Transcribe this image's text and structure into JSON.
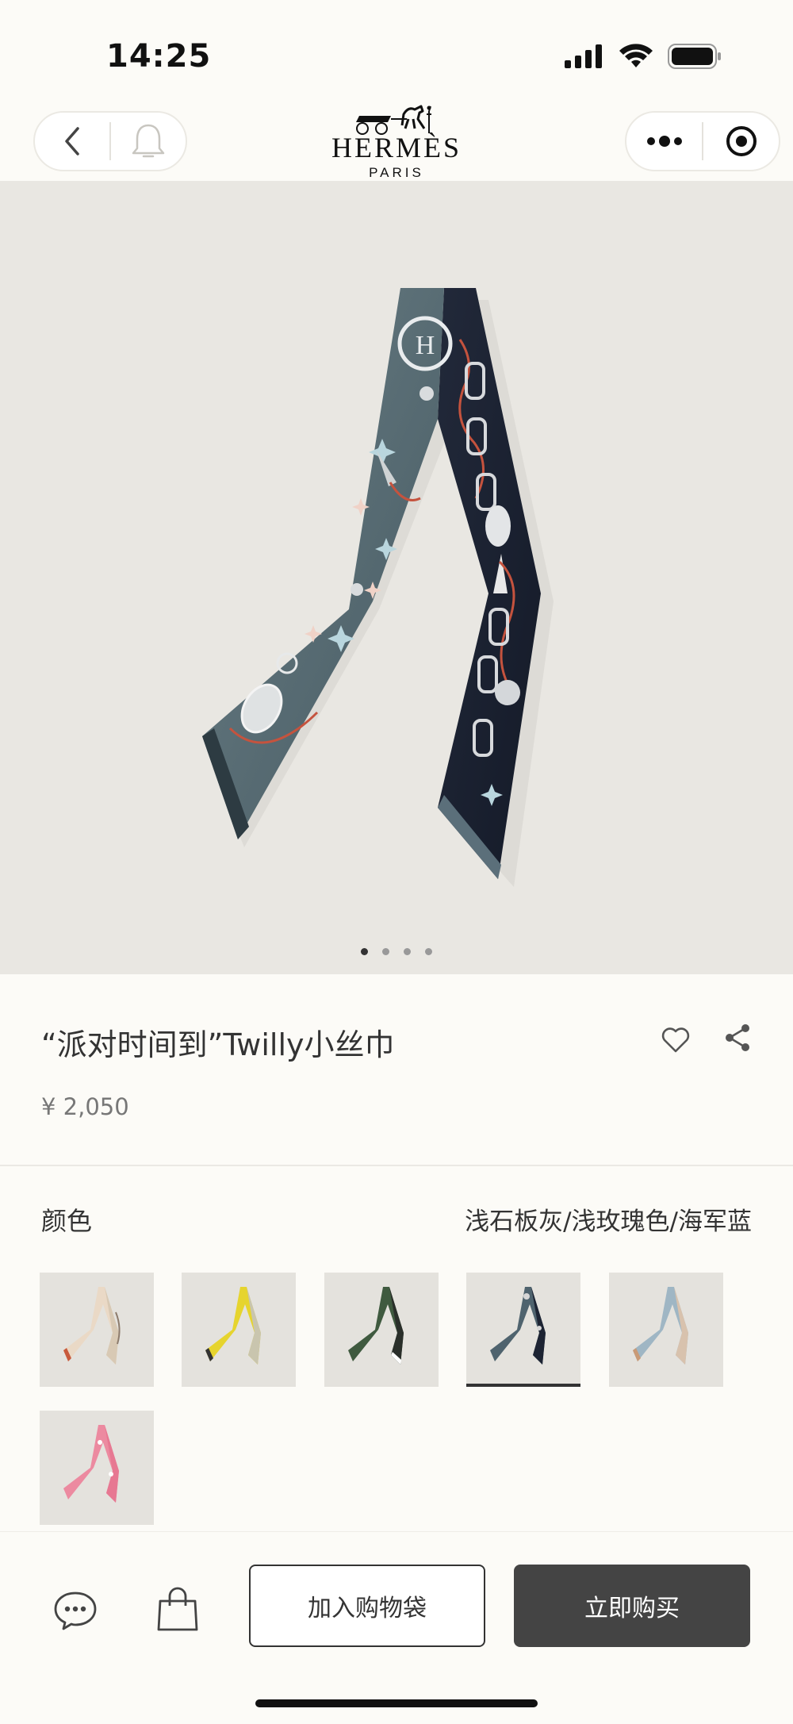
{
  "status_bar": {
    "time": "14:25"
  },
  "header": {
    "brand": "HERMÈS",
    "brand_sub": "PARIS"
  },
  "carousel": {
    "total": 4,
    "active": 1
  },
  "product": {
    "title": "“派对时间到”Twilly小丝巾",
    "price": "¥ 2,050"
  },
  "color": {
    "label": "颜色",
    "selected_name": "浅石板灰/浅玫瑰色/海军蓝",
    "swatches": [
      {
        "left": "#ead9c6",
        "right": "#d8c9b4",
        "accent": "#c85a3c"
      },
      {
        "left": "#e6d42e",
        "right": "#c9c5ae",
        "accent": "#333333"
      },
      {
        "left": "#3f5a3f",
        "right": "#2a2f2a",
        "accent": "#ffffff"
      },
      {
        "left": "#4f636e",
        "right": "#1d2433",
        "accent": "#d6d6d6"
      },
      {
        "left": "#9fb6c4",
        "right": "#d8c2ad",
        "accent": "#c99a76"
      },
      {
        "left": "#ec8aa0",
        "right": "#e77892",
        "accent": "#ffffff"
      }
    ],
    "selected_index": 3
  },
  "actions": {
    "add_to_bag": "加入购物袋",
    "buy_now": "立即购买"
  }
}
